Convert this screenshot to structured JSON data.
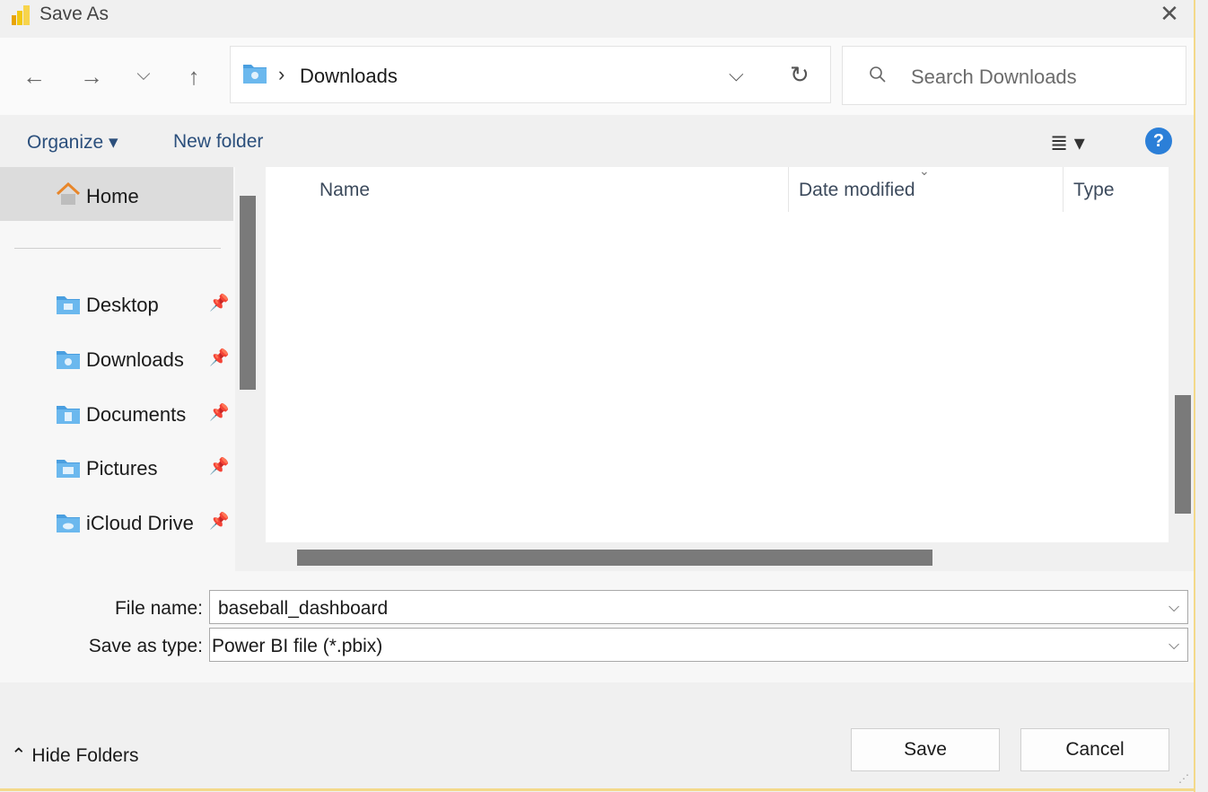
{
  "window": {
    "title": "Save As",
    "close_glyph": "✕"
  },
  "nav": {
    "back_glyph": "←",
    "forward_glyph": "→",
    "recent_glyph": "⌵",
    "up_glyph": "↑",
    "address_separator": "›",
    "address_location": "Downloads",
    "address_chevron": "⌵",
    "refresh_glyph": "↻",
    "search_placeholder": "Search Downloads"
  },
  "toolbar": {
    "organize_label": "Organize ▾",
    "new_folder_label": "New folder",
    "view_glyph": "≣ ▾",
    "help_label": "?"
  },
  "sidebar": {
    "home_label": "Home",
    "pin_glyph": "📌",
    "items": [
      {
        "label": "Desktop",
        "icon": "desktop-folder-icon"
      },
      {
        "label": "Downloads",
        "icon": "downloads-folder-icon"
      },
      {
        "label": "Documents",
        "icon": "documents-folder-icon"
      },
      {
        "label": "Pictures",
        "icon": "pictures-folder-icon"
      },
      {
        "label": "iCloud Drive",
        "icon": "icloud-folder-icon"
      }
    ]
  },
  "file_list": {
    "columns": [
      "Name",
      "Date modified",
      "Type"
    ],
    "sort_glyph": "⌄"
  },
  "form": {
    "file_name_label": "File name:",
    "file_name_value": "baseball_dashboard",
    "save_type_label": "Save as type:",
    "save_type_value": "Power BI file (*.pbix)",
    "dropdown_glyph": "⌵"
  },
  "footer": {
    "hide_folders_label": "⌃ Hide Folders",
    "save_label": "Save",
    "cancel_label": "Cancel"
  },
  "colors": {
    "accent": "#2b7fd8",
    "folder_blue": "#5aa9e6",
    "window_border": "#f3d98a"
  }
}
